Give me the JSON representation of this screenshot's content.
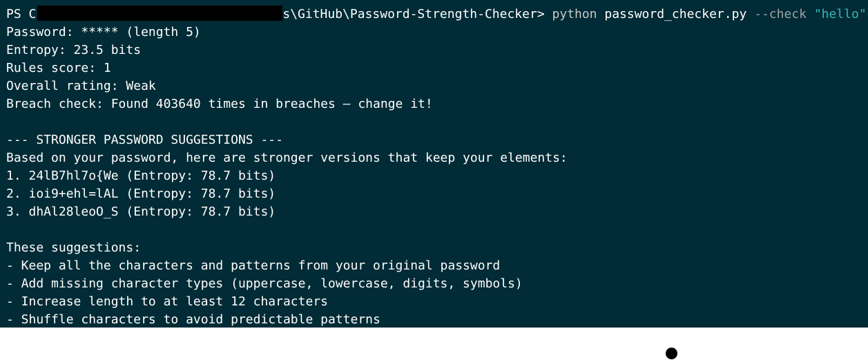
{
  "prompt": {
    "ps": "PS C",
    "path_tail": "s\\GitHub\\Password-Strength-Checker>",
    "python": "python",
    "script": "password_checker.py",
    "flag": "--check",
    "arg": "\"hello\""
  },
  "result": {
    "password": "Password: ***** (length 5)",
    "entropy": "Entropy: 23.5 bits",
    "rules_score": "Rules score: 1",
    "overall_rating": "Overall rating: Weak",
    "breach_check": "Breach check: Found 403640 times in breaches — change it!"
  },
  "suggestions": {
    "header": "--- STRONGER PASSWORD SUGGESTIONS ---",
    "intro": "Based on your password, here are stronger versions that keep your elements:",
    "items": [
      "1. 24lB7hl7o{We (Entropy: 78.7 bits)",
      "2. ioi9+ehl=lAL (Entropy: 78.7 bits)",
      "3. dhAl28leoO_S (Entropy: 78.7 bits)"
    ]
  },
  "notes": {
    "header": "These suggestions:",
    "items": [
      "- Keep all the characters and patterns from your original password",
      "- Add missing character types (uppercase, lowercase, digits, symbols)",
      "- Increase length to at least 12 characters",
      "- Shuffle characters to avoid predictable patterns"
    ]
  },
  "colors": {
    "terminal_bg": "#012b36",
    "text": "#ffffff",
    "string_literal": "#36b7b7"
  }
}
